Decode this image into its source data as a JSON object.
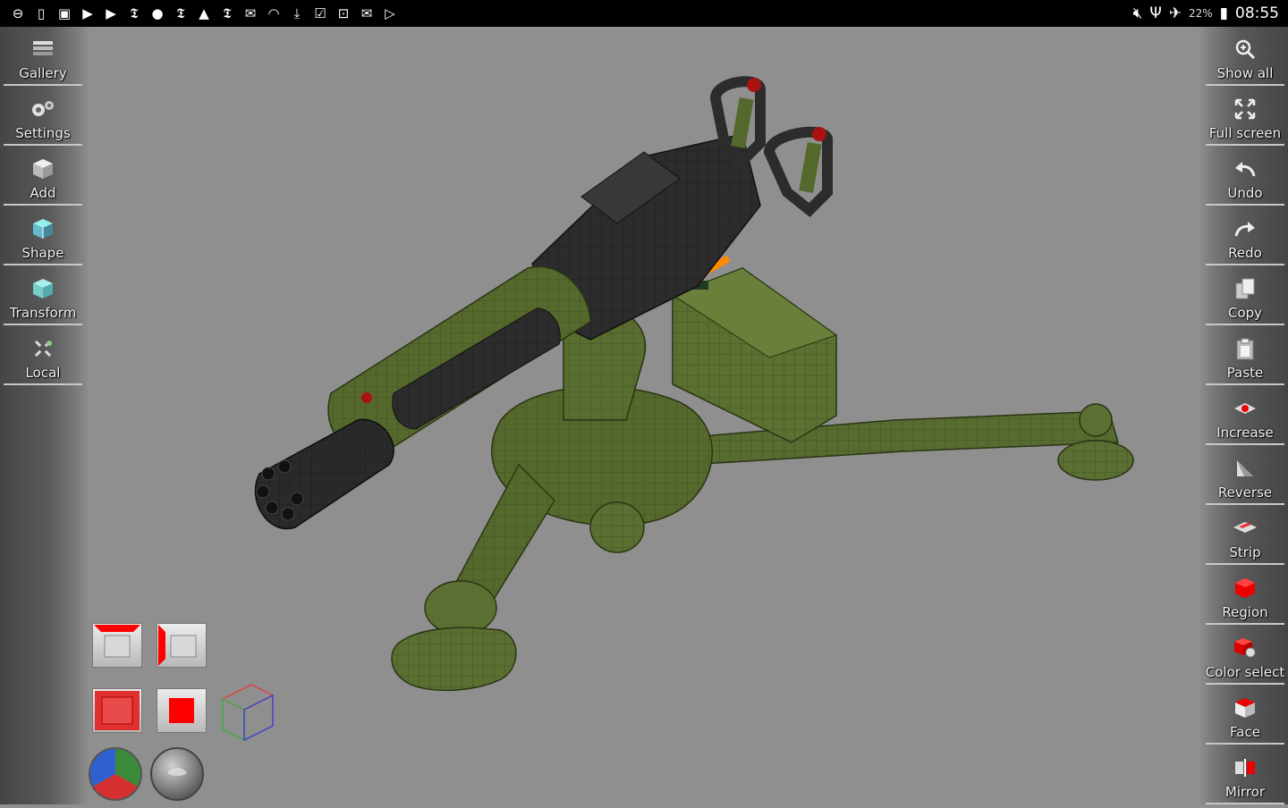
{
  "status_bar": {
    "left_icons": [
      "notification-icon",
      "clipboard-icon",
      "image-icon",
      "youtube-icon",
      "youtube-icon",
      "newspaper-icon",
      "circle-icon",
      "newspaper-icon",
      "triangle-icon",
      "newspaper-icon",
      "mail-icon",
      "wifi-icon",
      "download-icon",
      "check-icon",
      "mail-icon",
      "mail-icon",
      "play-store-icon"
    ],
    "battery": "22%",
    "time": "08:55"
  },
  "left_toolbar": [
    {
      "label": "Gallery",
      "icon": "gallery-icon"
    },
    {
      "label": "Settings",
      "icon": "settings-icon"
    },
    {
      "label": "Add",
      "icon": "add-cube-icon"
    },
    {
      "label": "Shape",
      "icon": "shape-icon"
    },
    {
      "label": "Transform",
      "icon": "transform-icon"
    },
    {
      "label": "Local",
      "icon": "local-icon"
    }
  ],
  "right_toolbar": [
    {
      "label": "Show all",
      "icon": "zoom-icon"
    },
    {
      "label": "Full screen",
      "icon": "fullscreen-icon"
    },
    {
      "label": "Undo",
      "icon": "undo-icon"
    },
    {
      "label": "Redo",
      "icon": "redo-icon"
    },
    {
      "label": "Copy",
      "icon": "copy-icon"
    },
    {
      "label": "Paste",
      "icon": "paste-icon"
    },
    {
      "label": "Increase",
      "icon": "increase-icon"
    },
    {
      "label": "Reverse",
      "icon": "reverse-icon"
    },
    {
      "label": "Strip",
      "icon": "strip-icon"
    },
    {
      "label": "Region",
      "icon": "region-icon"
    },
    {
      "label": "Color select",
      "icon": "color-select-icon"
    },
    {
      "label": "Face",
      "icon": "face-icon"
    },
    {
      "label": "Mirror",
      "icon": "mirror-icon"
    }
  ],
  "colors": {
    "model_green": "#556b2f",
    "model_dark": "#2e2e2e",
    "viewport_bg": "#8f8f8f",
    "accent_red": "#ff0000"
  }
}
